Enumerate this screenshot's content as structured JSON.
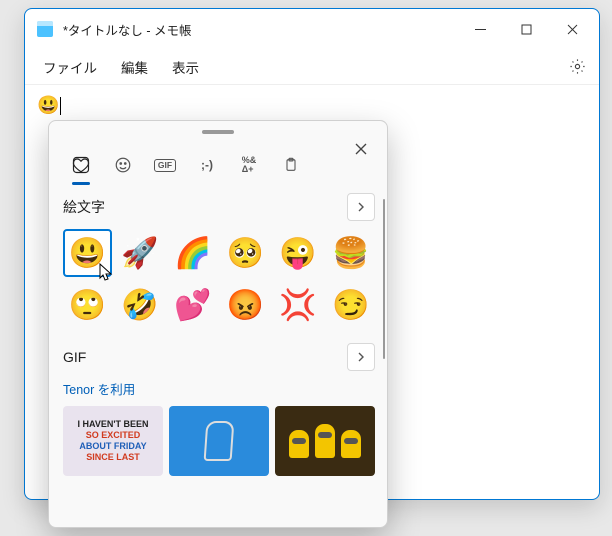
{
  "window": {
    "title": "*タイトルなし - メモ帳"
  },
  "menus": {
    "file": "ファイル",
    "edit": "編集",
    "view": "表示"
  },
  "editor": {
    "content_emoji": "😃"
  },
  "picker": {
    "tabs": {
      "gif_label": "GIF",
      "kaomoji_label": ";-)",
      "symbols_label": "%&\nΔ+"
    },
    "sections": {
      "emoji_title": "絵文字",
      "gif_title": "GIF",
      "tenor_credit": "Tenor を利用"
    },
    "emojis": [
      "😃",
      "🚀",
      "🌈",
      "🥺",
      "😜",
      "🍔",
      "🙄",
      "🤣",
      "💕",
      "😡",
      "💢",
      "😏"
    ],
    "gif_thumbs": {
      "t1_l1": "I HAVEN'T BEEN",
      "t1_l2": "SO EXCITED",
      "t1_l3": "ABOUT FRIDAY",
      "t1_l4": "SINCE LAST"
    }
  }
}
